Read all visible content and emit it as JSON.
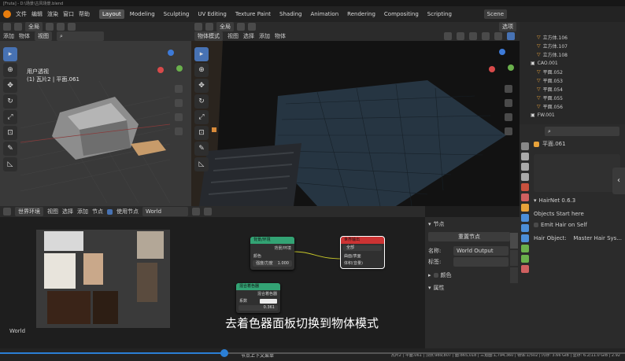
{
  "title_bar": {
    "text": "[Fruta] - D:\\场景\\古风场景.blend"
  },
  "menu": [
    "文件",
    "编辑",
    "渲染",
    "窗口",
    "帮助"
  ],
  "workspaces": [
    "Layout",
    "Modeling",
    "Sculpting",
    "UV Editing",
    "Texture Paint",
    "Shading",
    "Animation",
    "Rendering",
    "Compositing",
    "Scripting"
  ],
  "active_workspace": "Layout",
  "scene_name": "Scene",
  "left_viewport": {
    "header": [
      "添加",
      "物体"
    ],
    "mode": "视图",
    "overlay_title": "用户透视",
    "overlay_sub": "(1) 瓦片2 | 平面.061"
  },
  "right_viewport": {
    "mode": "物体模式",
    "menu": [
      "视图",
      "选择",
      "添加",
      "物体"
    ],
    "global": "全局",
    "view_select": "选项"
  },
  "outliner": {
    "items": [
      {
        "name": "立方体.106"
      },
      {
        "name": "立方体.107"
      },
      {
        "name": "立方体.108"
      },
      {
        "name": "CAO.001"
      },
      {
        "name": "平面.052"
      },
      {
        "name": "平面.053"
      },
      {
        "name": "平面.054"
      },
      {
        "name": "平面.055"
      },
      {
        "name": "平面.056"
      },
      {
        "name": "FW.001"
      }
    ]
  },
  "properties": {
    "object_name": "平面.061",
    "addon_title": "HairNet 0.6.3",
    "objects_start_here": "Objects Start here",
    "emit_hair": "Emit Hair on Self",
    "hair_object_label": "Hair Object:",
    "hair_object_value": "Master Hair Sys..."
  },
  "node_editor": {
    "header": [
      "视图",
      "选择",
      "添加",
      "节点"
    ],
    "world_mode": "世界环境",
    "use_nodes": "使用节点",
    "world_name": "World",
    "corner_label": "World",
    "bg_node_title": "背景/环境",
    "bg_out": "背景/环境",
    "bg_color": "颜色",
    "bg_strength": "强度/力度",
    "bg_strength_val": "1.000",
    "output_title": "世界输出",
    "output_target": "全部",
    "output_surface": "曲面/表面",
    "output_volume": "体积(音量)",
    "mix_title": "混合着色器",
    "mix_label": "混合着色器",
    "mix_fac": "系数",
    "mix_val": "0.361"
  },
  "node_sidebar": {
    "tab": "节点",
    "reset": "重置节点",
    "name_label": "名称:",
    "name_value": "World Output",
    "label_label": "标签:",
    "color_section": "颜色",
    "props_section": "属性"
  },
  "subtitle": "去着色器面板切换到物体模式",
  "status_bar": {
    "left": "节点上下文菜单",
    "right": "瓦片2 | 平面.061 | 顶点:989,807 | 面:865,018 | 三角面:1,794,360 | 物体:1/502 | 内存: 3.66 GiB | 显存: 6.2/11.0 GiB | 2.92"
  },
  "colors": {
    "accent": "#4772b3",
    "node_green": "#33a374",
    "node_red": "#cc3333",
    "progress_blue": "#2b7fd6"
  }
}
